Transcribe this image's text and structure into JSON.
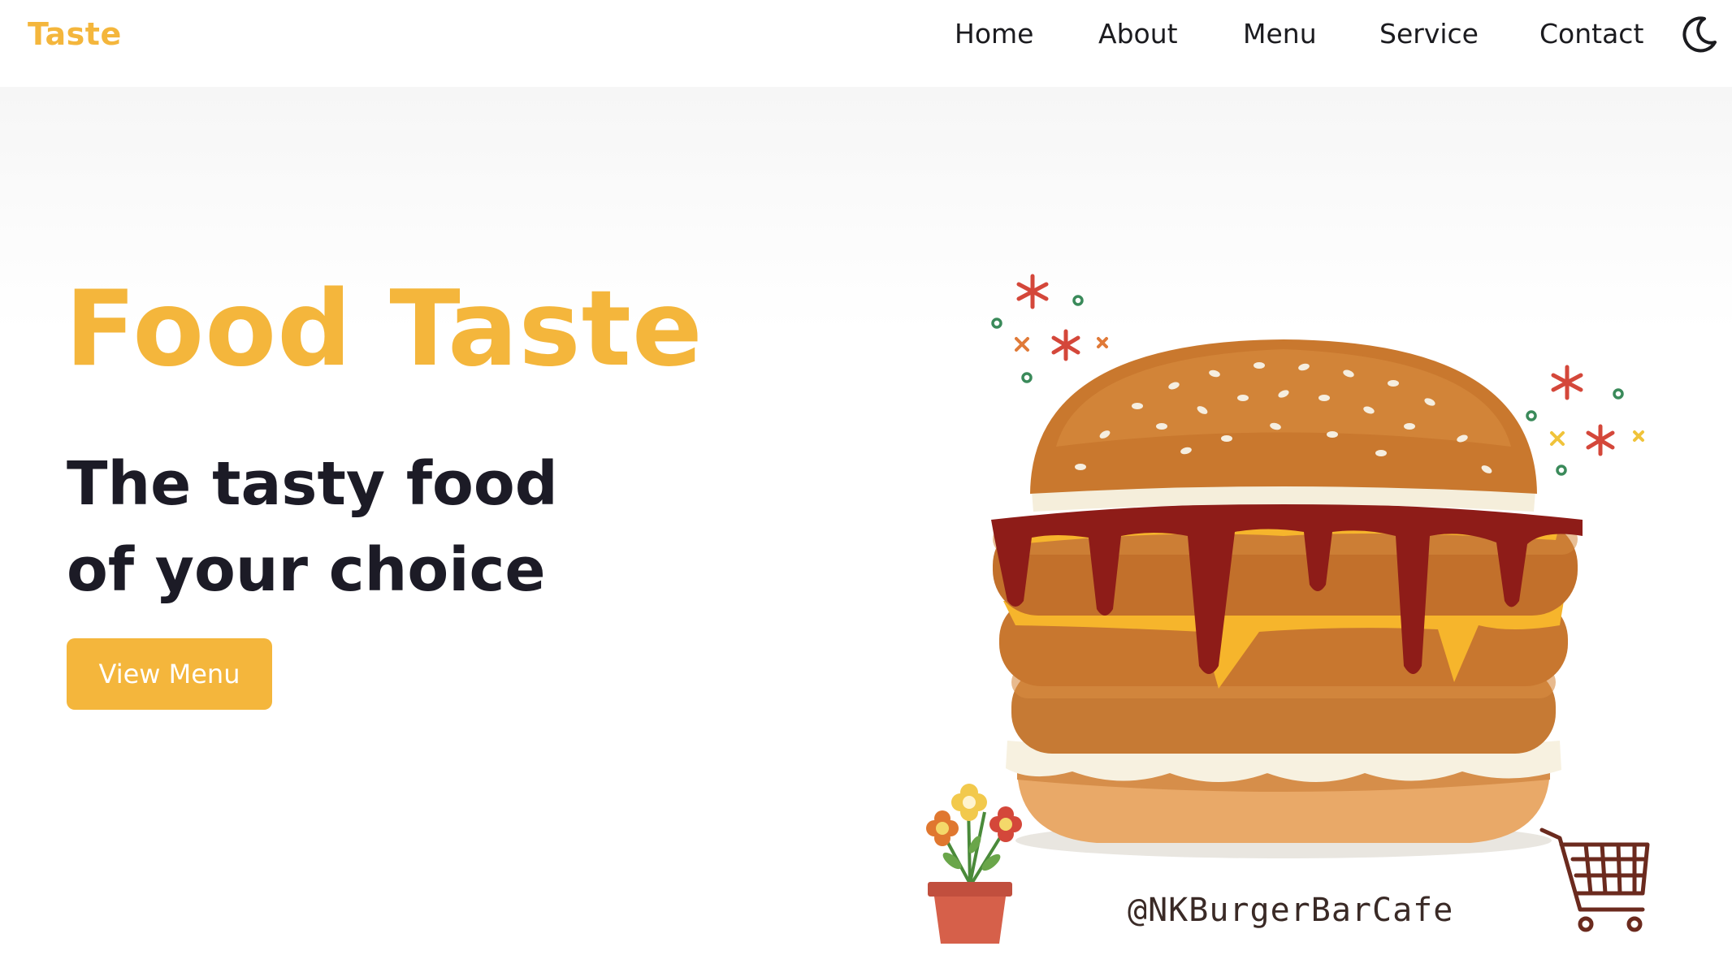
{
  "brand": {
    "logo": "Taste"
  },
  "nav": {
    "items": [
      {
        "label": "Home"
      },
      {
        "label": "About"
      },
      {
        "label": "Menu"
      },
      {
        "label": "Service"
      },
      {
        "label": "Contact"
      }
    ],
    "theme_toggle_icon": "moon-icon"
  },
  "hero": {
    "title": "Food Taste",
    "subtitle": "The tasty food of your choice",
    "cta_label": "View Menu",
    "social_handle": "@NKBurgerBarCafe"
  },
  "colors": {
    "accent": "#f4b63c",
    "heading": "#1c1b26",
    "nav_text": "#1b1b1f",
    "background": "#ffffff"
  },
  "illustration": {
    "main_image": "burger-image",
    "decorations": [
      "flower-pot-icon",
      "shopping-cart-icon",
      "sparkle-icon"
    ]
  }
}
